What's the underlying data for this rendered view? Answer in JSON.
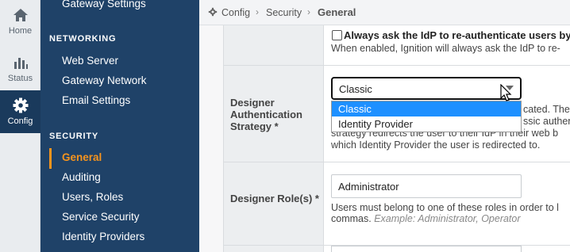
{
  "rail": {
    "home": "Home",
    "status": "Status",
    "config": "Config"
  },
  "sidebar": {
    "top_item": "Gateway Settings",
    "networking": {
      "title": "NETWORKING",
      "items": [
        "Web Server",
        "Gateway Network",
        "Email Settings"
      ]
    },
    "security": {
      "title": "SECURITY",
      "items": [
        "General",
        "Auditing",
        "Users, Roles",
        "Service Security",
        "Identity Providers"
      ]
    }
  },
  "breadcrumb": {
    "root": "Config",
    "section": "Security",
    "current": "General"
  },
  "main": {
    "reauth": {
      "checked": false,
      "label": "Always ask the IdP to re-authenticate users by",
      "help": "When enabled, Ignition will always ask the IdP to re-"
    },
    "designer_auth": {
      "label_lines": [
        "Designer",
        "Authentication",
        "Strategy *"
      ],
      "value": "Classic",
      "options": [
        "Classic",
        "Identity Provider"
      ],
      "help_lines": [
        "cated. The",
        "ssic authen",
        "strategy redirects the user to their IdP in their web b",
        "which Identity Provider the user is redirected to."
      ]
    },
    "designer_roles": {
      "label": "Designer Role(s) *",
      "value": "Administrator",
      "help_line1": "Users must belong to one of these roles in order to l",
      "help_line2": "commas.",
      "example": "Example: Administrator, Operator"
    }
  },
  "colors": {
    "sidebar_bg": "#1f4268",
    "accent": "#f7941d",
    "selected_option": "#1e90ff"
  }
}
